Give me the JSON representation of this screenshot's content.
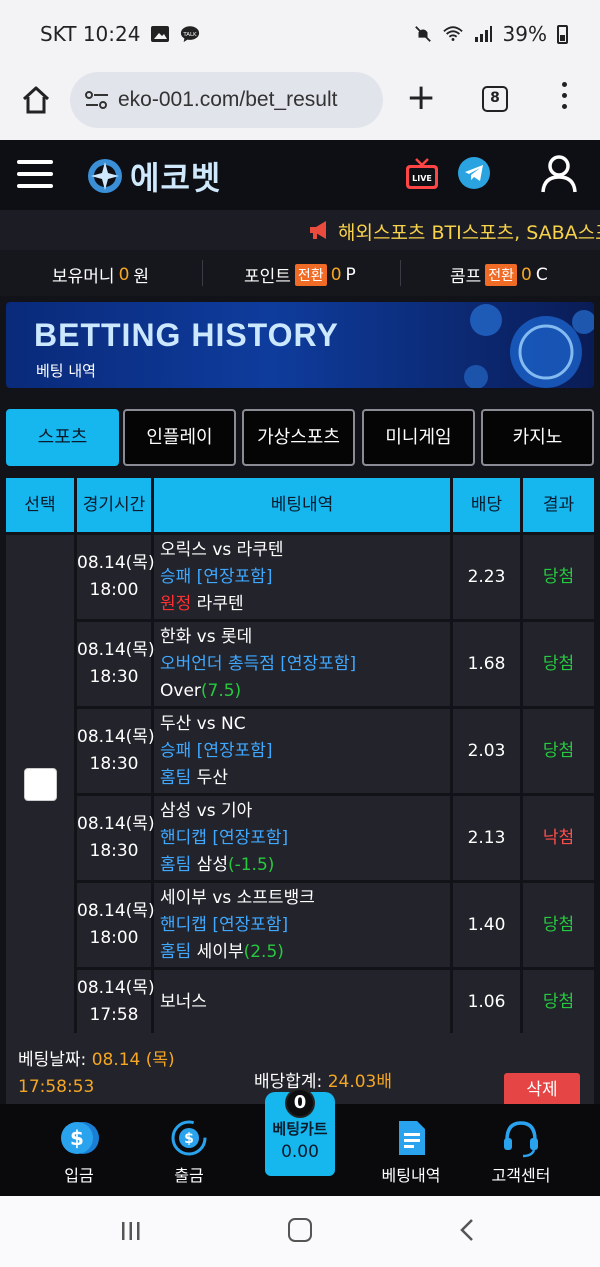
{
  "status_bar": {
    "carrier_time": "SKT 10:24",
    "battery": "39%"
  },
  "browser": {
    "url": "eko-001.com/bet_result",
    "tab_count": "8"
  },
  "site": {
    "logo_text": "에코벳",
    "live_label": "LIVE",
    "ticker_text": "해외스포츠 BTI스포츠, SABA스포츠"
  },
  "money_bar": {
    "holding_label": "보유머니",
    "holding_value": "0",
    "holding_unit": "원",
    "point_label": "포인트",
    "point_badge": "전환",
    "point_value": "0",
    "point_unit": "P",
    "comp_label": "콤프",
    "comp_badge": "전환",
    "comp_value": "0",
    "comp_unit": "C"
  },
  "banner": {
    "title": "BETTING HISTORY",
    "subtitle": "베팅 내역"
  },
  "tabs": [
    {
      "label": "스포츠",
      "active": true
    },
    {
      "label": "인플레이",
      "active": false
    },
    {
      "label": "가상스포츠",
      "active": false
    },
    {
      "label": "미니게임",
      "active": false
    },
    {
      "label": "카지노",
      "active": false
    }
  ],
  "table": {
    "headers": [
      "선택",
      "경기시간",
      "베팅내역",
      "배당",
      "결과"
    ],
    "rows": [
      {
        "date": "08.14(목)",
        "time": "18:00",
        "match": "오릭스 vs 라쿠텐",
        "market": "승패 [연장포함]",
        "pick_prefix": "원정",
        "pick_prefix_color": "red",
        "pick": " 라쿠텐",
        "pick_extra": "",
        "odds": "2.23",
        "result": "당첨",
        "result_color": "green"
      },
      {
        "date": "08.14(목)",
        "time": "18:30",
        "match": "한화 vs 롯데",
        "market": "오버언더 총득점 [연장포함]",
        "pick_prefix": "",
        "pick_prefix_color": "",
        "pick": "Over",
        "pick_extra": "(7.5)",
        "odds": "1.68",
        "result": "당첨",
        "result_color": "green"
      },
      {
        "date": "08.14(목)",
        "time": "18:30",
        "match": "두산 vs NC",
        "market": "승패 [연장포함]",
        "pick_prefix": "홈팀",
        "pick_prefix_color": "blue",
        "pick": " 두산",
        "pick_extra": "",
        "odds": "2.03",
        "result": "당첨",
        "result_color": "green"
      },
      {
        "date": "08.14(목)",
        "time": "18:30",
        "match": "삼성 vs 기아",
        "market": "핸디캡 [연장포함]",
        "pick_prefix": "홈팀",
        "pick_prefix_color": "blue",
        "pick": " 삼성",
        "pick_extra": "(-1.5)",
        "odds": "2.13",
        "result": "낙첨",
        "result_color": "red"
      },
      {
        "date": "08.14(목)",
        "time": "18:00",
        "match": "세이부 vs 소프트뱅크",
        "market": "핸디캡 [연장포함]",
        "pick_prefix": "홈팀",
        "pick_prefix_color": "blue",
        "pick": " 세이부",
        "pick_extra": "(2.5)",
        "odds": "1.40",
        "result": "당첨",
        "result_color": "green"
      },
      {
        "date": "08.14(목)",
        "time": "17:58",
        "match": "보너스",
        "market": "",
        "pick_prefix": "",
        "pick_prefix_color": "",
        "pick": "",
        "pick_extra": "",
        "odds": "1.06",
        "result": "당첨",
        "result_color": "green"
      }
    ]
  },
  "summary": {
    "bet_date_label": "베팅날짜: ",
    "bet_date_value": "08.14 (목)",
    "bet_time_value": "17:58:53",
    "total_odds_label": "배당합계: ",
    "total_odds_value": "24.03배",
    "delete_label": "삭제"
  },
  "bottom_nav": {
    "deposit": "입금",
    "withdraw": "출금",
    "cart_label": "베팅카트",
    "cart_amount": "0.00",
    "cart_count": "0",
    "history": "베팅내역",
    "support": "고객센터"
  },
  "colors": {
    "accent": "#16b6ef",
    "win": "#27c93f",
    "lose": "#ff4d4d",
    "highlight": "#f5a623"
  }
}
